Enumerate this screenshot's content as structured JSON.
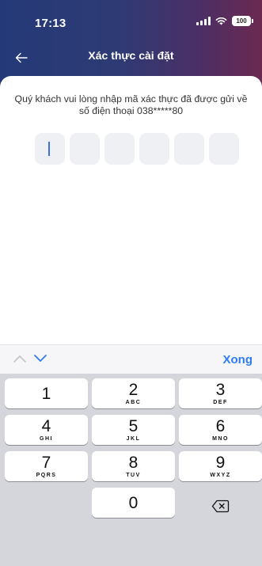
{
  "status_bar": {
    "time": "17:13",
    "battery": "100"
  },
  "nav": {
    "title": "Xác thực cài đặt"
  },
  "instruction": "Quý khách vui lòng nhập mã xác thực đã được gửi về số điện thoại 038*****80",
  "otp": {
    "box_count": 6,
    "values": [
      "",
      "",
      "",
      "",
      "",
      ""
    ]
  },
  "keyboard_toolbar": {
    "done_label": "Xong"
  },
  "keypad": {
    "keys": [
      {
        "digit": "1",
        "letters": ""
      },
      {
        "digit": "2",
        "letters": "ABC"
      },
      {
        "digit": "3",
        "letters": "DEF"
      },
      {
        "digit": "4",
        "letters": "GHI"
      },
      {
        "digit": "5",
        "letters": "JKL"
      },
      {
        "digit": "6",
        "letters": "MNO"
      },
      {
        "digit": "7",
        "letters": "PQRS"
      },
      {
        "digit": "8",
        "letters": "TUV"
      },
      {
        "digit": "9",
        "letters": "WXYZ"
      },
      {
        "digit": "0",
        "letters": ""
      }
    ]
  },
  "colors": {
    "header_start": "#243a78",
    "header_end": "#6b2950",
    "accent": "#2f7cf6",
    "otp_box": "#eef0f4",
    "keyboard_bg": "#d4d6dc"
  }
}
